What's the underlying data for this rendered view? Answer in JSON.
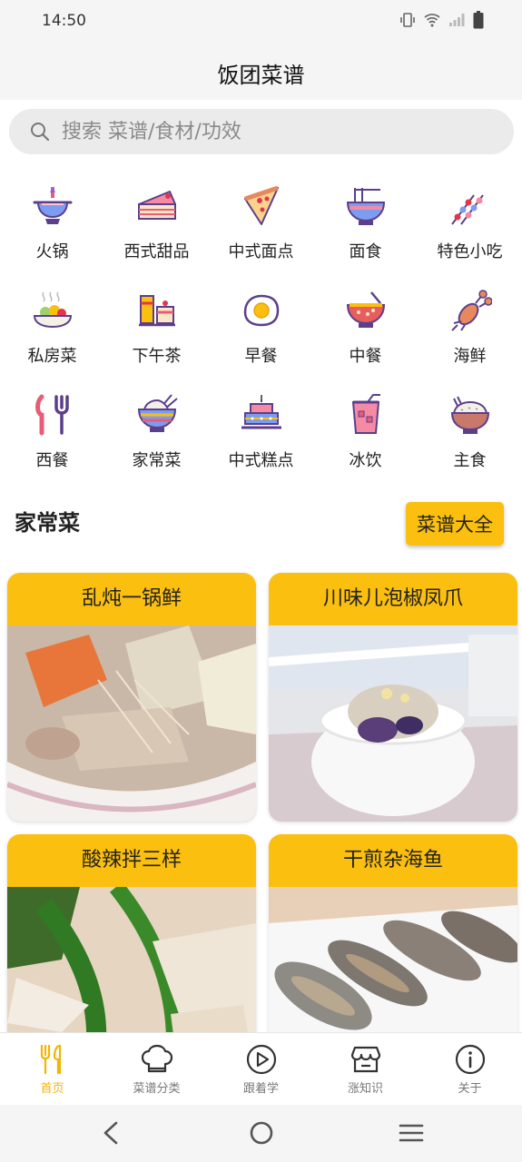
{
  "status": {
    "time": "14:50"
  },
  "app": {
    "title": "饭团菜谱"
  },
  "search": {
    "placeholder": "搜索 菜谱/食材/功效"
  },
  "categories": [
    {
      "label": "火锅",
      "icon": "hotpot-icon"
    },
    {
      "label": "西式甜品",
      "icon": "cake-slice-icon"
    },
    {
      "label": "中式面点",
      "icon": "pizza-slice-icon"
    },
    {
      "label": "面食",
      "icon": "noodle-bowl-icon"
    },
    {
      "label": "特色小吃",
      "icon": "skewers-icon"
    },
    {
      "label": "私房菜",
      "icon": "salad-plate-icon"
    },
    {
      "label": "下午茶",
      "icon": "afternoon-tea-icon"
    },
    {
      "label": "早餐",
      "icon": "fried-egg-icon"
    },
    {
      "label": "中餐",
      "icon": "soup-bowl-icon"
    },
    {
      "label": "海鲜",
      "icon": "lobster-icon"
    },
    {
      "label": "西餐",
      "icon": "knife-fork-icon"
    },
    {
      "label": "家常菜",
      "icon": "rice-bowl-chopsticks-icon"
    },
    {
      "label": "中式糕点",
      "icon": "layer-cake-icon"
    },
    {
      "label": "冰饮",
      "icon": "iced-drink-icon"
    },
    {
      "label": "主食",
      "icon": "rice-bowl-icon"
    }
  ],
  "section": {
    "title": "家常菜",
    "button": "菜谱大全"
  },
  "recipes": [
    {
      "title": "乱炖一锅鲜"
    },
    {
      "title": "川味儿泡椒凤爪"
    },
    {
      "title": "酸辣拌三样"
    },
    {
      "title": "干煎杂海鱼"
    }
  ],
  "nav": [
    {
      "label": "首页",
      "icon": "utensils-icon"
    },
    {
      "label": "菜谱分类",
      "icon": "chef-hat-icon"
    },
    {
      "label": "跟着学",
      "icon": "play-circle-icon"
    },
    {
      "label": "涨知识",
      "icon": "shop-icon"
    },
    {
      "label": "关于",
      "icon": "info-icon"
    }
  ],
  "colors": {
    "accent": "#fbbf0f",
    "active_nav": "#f4b400",
    "background": "#f5f5f5"
  }
}
